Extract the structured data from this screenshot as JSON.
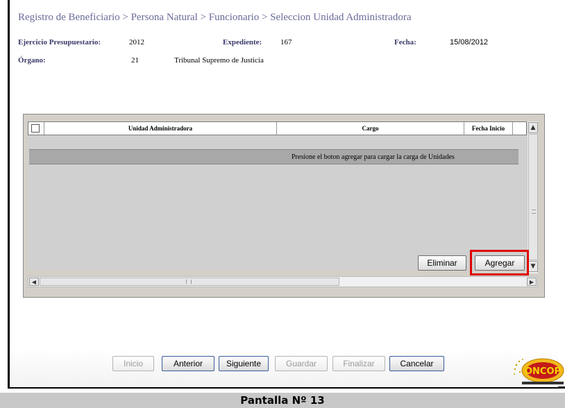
{
  "header": {
    "breadcrumb": "Registro de Beneficiario > Persona Natural > Funcionario > Seleccion Unidad Administradora"
  },
  "info": {
    "ejercicio_label": "Ejercicio Presupuestario:",
    "ejercicio_value": "2012",
    "expediente_label": "Expediente:",
    "expediente_value": "167",
    "fecha_label": "Fecha:",
    "fecha_value": "15/08/2012",
    "organo_label": "Órgano:",
    "organo_code": "21",
    "organo_name": "Tribunal Supremo de Justicia"
  },
  "grid": {
    "columns": [
      "Unidad Administradora",
      "Cargo",
      "Fecha Inicio"
    ],
    "empty_message": "Presione el boton agregar para cargar la carga de Unidades"
  },
  "actions": {
    "eliminar": "Eliminar",
    "agregar": "Agregar"
  },
  "footer": {
    "buttons": [
      {
        "label": "Inicio",
        "enabled": false
      },
      {
        "label": "Anterior",
        "enabled": true
      },
      {
        "label": "Siguiente",
        "enabled": true
      },
      {
        "label": "Guardar",
        "enabled": false
      },
      {
        "label": "Finalizar",
        "enabled": false
      },
      {
        "label": "Cancelar",
        "enabled": true
      }
    ]
  },
  "logo": {
    "text": "ONCOP",
    "icon": "oncop-logo"
  },
  "caption": "Pantalla Nº 13",
  "colors": {
    "highlight": "#e00000",
    "breadcrumb": "#6a6a9a",
    "grid_bg": "#d0d0d0"
  }
}
